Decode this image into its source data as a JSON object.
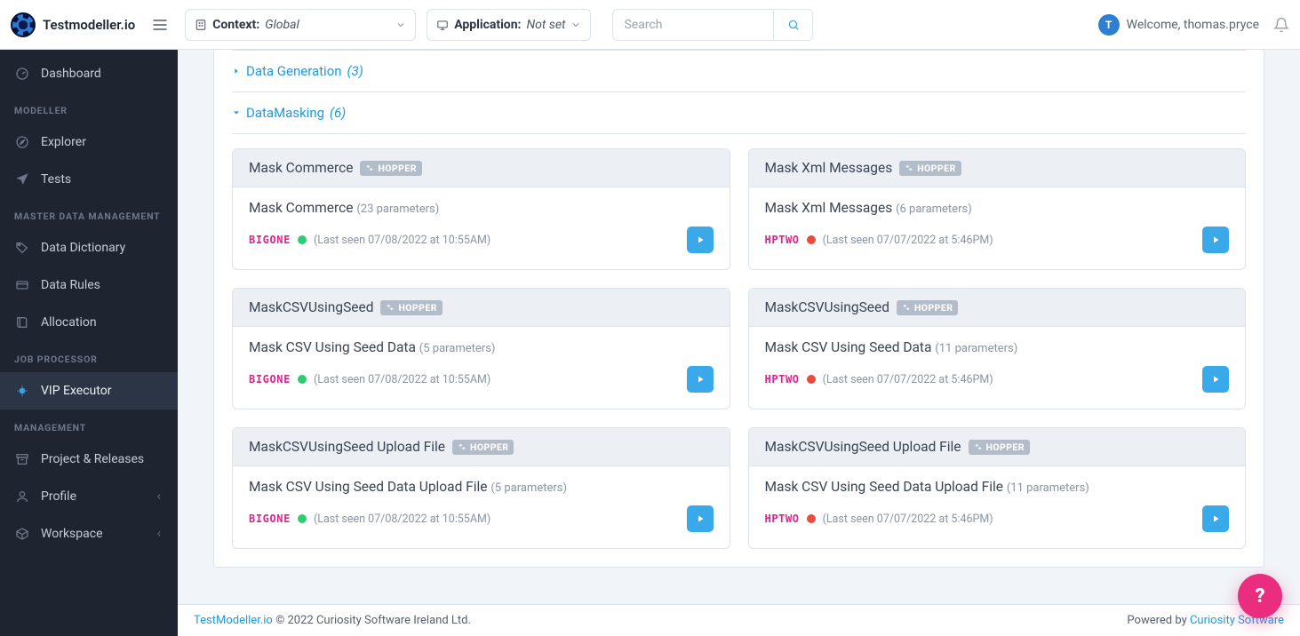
{
  "brand": {
    "name": "Testmodeller.io"
  },
  "topbar": {
    "context_label": "Context:",
    "context_value": "Global",
    "application_label": "Application:",
    "application_value": "Not set",
    "search_placeholder": "Search",
    "avatar_initial": "T",
    "welcome_text": "Welcome, thomas.pryce"
  },
  "sidebar": {
    "items": [
      {
        "name": "dashboard",
        "label": "Dashboard",
        "section": null,
        "icon": "gauge-icon"
      },
      {
        "name": "modeller",
        "label": "MODELLER",
        "section": true
      },
      {
        "name": "explorer",
        "label": "Explorer",
        "icon": "compass-icon"
      },
      {
        "name": "tests",
        "label": "Tests",
        "icon": "plane-icon"
      },
      {
        "name": "mdm",
        "label": "MASTER DATA MANAGEMENT",
        "section": true
      },
      {
        "name": "data-dictionary",
        "label": "Data Dictionary",
        "icon": "tag-icon"
      },
      {
        "name": "data-rules",
        "label": "Data Rules",
        "icon": "card-icon"
      },
      {
        "name": "allocation",
        "label": "Allocation",
        "icon": "book-icon"
      },
      {
        "name": "job-proc",
        "label": "JOB PROCESSOR",
        "section": true
      },
      {
        "name": "vip-executor",
        "label": "VIP Executor",
        "icon": "bug-icon",
        "active": true
      },
      {
        "name": "management",
        "label": "MANAGEMENT",
        "section": true
      },
      {
        "name": "project-releases",
        "label": "Project & Releases",
        "icon": "archive-icon"
      },
      {
        "name": "profile",
        "label": "Profile",
        "icon": "user-icon",
        "chevron": true
      },
      {
        "name": "workspace",
        "label": "Workspace",
        "icon": "box-icon",
        "chevron": true
      }
    ]
  },
  "accordion": {
    "data_generation": {
      "title": "Data Generation",
      "count": "(3)",
      "open": false
    },
    "data_masking": {
      "title": "DataMasking",
      "count": "(6)",
      "open": true
    }
  },
  "badges": {
    "hopper": "HOPPER"
  },
  "cards": [
    {
      "title": "Mask Commerce",
      "desc": "Mask Commerce",
      "params": "(23 parameters)",
      "host": "BIGONE",
      "status": "green",
      "last_seen": "(Last seen 07/08/2022 at 10:55AM)"
    },
    {
      "title": "Mask Xml Messages",
      "desc": "Mask Xml Messages",
      "params": "(6 parameters)",
      "host": "HPTWO",
      "status": "red",
      "last_seen": "(Last seen 07/07/2022 at 5:46PM)"
    },
    {
      "title": "MaskCSVUsingSeed",
      "desc": "Mask CSV Using Seed Data",
      "params": "(5 parameters)",
      "host": "BIGONE",
      "status": "green",
      "last_seen": "(Last seen 07/08/2022 at 10:55AM)"
    },
    {
      "title": "MaskCSVUsingSeed",
      "desc": "Mask CSV Using Seed Data",
      "params": "(11 parameters)",
      "host": "HPTWO",
      "status": "red",
      "last_seen": "(Last seen 07/07/2022 at 5:46PM)"
    },
    {
      "title": "MaskCSVUsingSeed Upload File",
      "desc": "Mask CSV Using Seed Data Upload File",
      "params": "(5 parameters)",
      "host": "BIGONE",
      "status": "green",
      "last_seen": "(Last seen 07/08/2022 at 10:55AM)"
    },
    {
      "title": "MaskCSVUsingSeed Upload File",
      "desc": "Mask CSV Using Seed Data Upload File",
      "params": "(11 parameters)",
      "host": "HPTWO",
      "status": "red",
      "last_seen": "(Last seen 07/07/2022 at 5:46PM)"
    }
  ],
  "footer": {
    "brand_link": "TestModeller.io",
    "copyright": " © 2022 Curiosity Software Ireland Ltd.",
    "powered_by_text": "Powered by ",
    "powered_by_link": "Curiosity Software"
  },
  "help": {
    "symbol": "?"
  }
}
